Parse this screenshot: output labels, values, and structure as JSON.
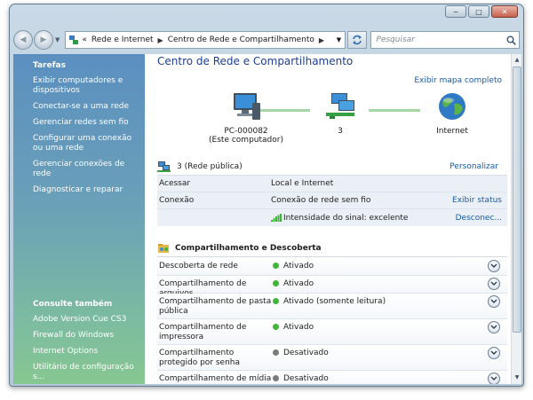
{
  "window": {
    "caption": {
      "minimize": "−",
      "maximize": "□",
      "close": "✕"
    }
  },
  "address": {
    "back_label": "◀",
    "forward_label": "▶",
    "chevrons": "«",
    "breadcrumb": [
      "Rede e Internet",
      "Centro de Rede e Compartilhamento"
    ],
    "separator": "▶",
    "search_placeholder": "Pesquisar"
  },
  "sidebar": {
    "tasks_title": "Tarefas",
    "tasks": [
      "Exibir computadores e dispositivos",
      "Conectar-se a uma rede",
      "Gerenciar redes sem fio",
      "Configurar uma conexão ou uma rede",
      "Gerenciar conexões de rede",
      "Diagnosticar e reparar"
    ],
    "see_also_title": "Consulte também",
    "see_also": [
      "Adobe Version Cue CS3",
      "Firewall do Windows",
      "Internet Options",
      "Utilitário de configuração s..."
    ]
  },
  "main": {
    "title": "Centro de Rede e Compartilhamento",
    "map_link": "Exibir mapa completo",
    "nodes": {
      "computer_name": "PC-000082",
      "computer_sub": "(Este computador)",
      "network_name": "3",
      "internet_name": "Internet"
    },
    "network": {
      "name": "3 (Rede pública)",
      "customize": "Personalizar",
      "access_label": "Acessar",
      "access_value": "Local e Internet",
      "connection_label": "Conexão",
      "connection_value": "Conexão de rede sem fio",
      "view_status": "Exibir status",
      "signal": "Intensidade do sinal: excelente",
      "disconnect": "Desconec..."
    },
    "sharing": {
      "title": "Compartilhamento e Descoberta",
      "rows": [
        {
          "label": "Descoberta de rede",
          "status": "Ativado",
          "state": "on"
        },
        {
          "label": "Compartilhamento de arquivos",
          "status": "Ativado",
          "state": "on"
        },
        {
          "label": "Compartilhamento de pasta pública",
          "status": "Ativado (somente leitura)",
          "state": "on"
        },
        {
          "label": "Compartilhamento de impressora",
          "status": "Ativado",
          "state": "on"
        },
        {
          "label": "Compartilhamento protegido por senha",
          "status": "Desativado",
          "state": "off"
        },
        {
          "label": "Compartilhamento de mídia",
          "status": "Desativado",
          "state": "off"
        }
      ]
    }
  },
  "colors": {
    "on": "#3fb53a",
    "off": "#7b7b7b",
    "link": "#1a5aa6",
    "title": "#1e3e8f"
  }
}
